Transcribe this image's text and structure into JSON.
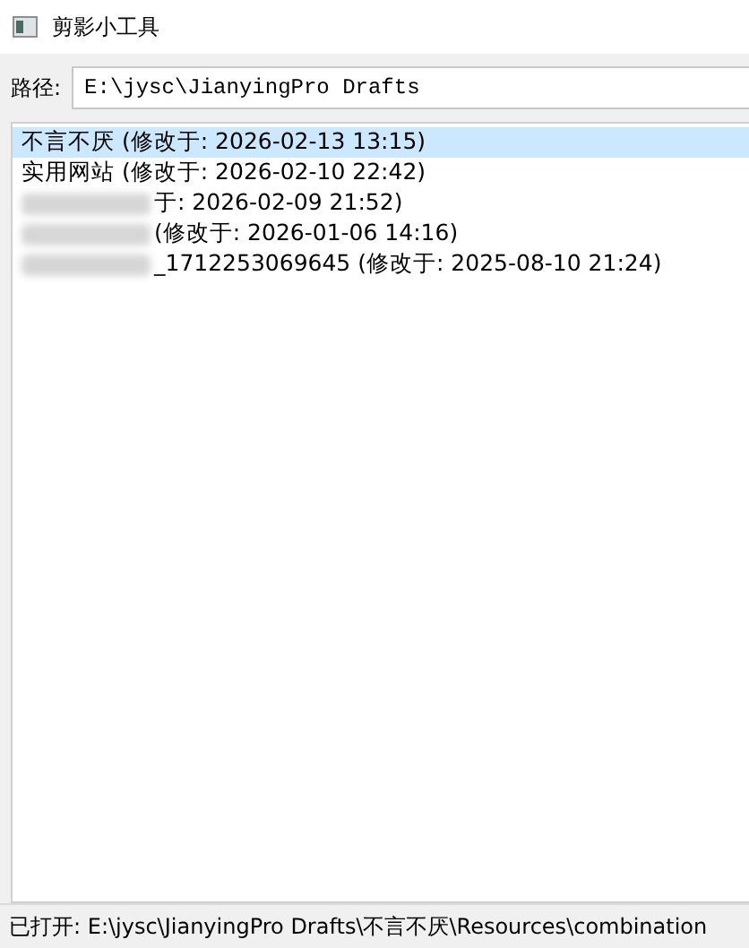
{
  "window": {
    "title": "剪影小工具"
  },
  "path": {
    "label": "路径:",
    "value": "E:\\jysc\\JianyingPro Drafts"
  },
  "drafts": [
    {
      "text": "不言不厌 (修改于: 2026-02-13 13:15)",
      "redacted": false,
      "selected": true
    },
    {
      "text": "实用网站 (修改于: 2026-02-10 22:42)",
      "redacted": false,
      "selected": false
    },
    {
      "text": "于: 2026-02-09 21:52)",
      "redacted": true,
      "selected": false
    },
    {
      "text": "(修改于: 2026-01-06 14:16)",
      "redacted": true,
      "selected": false
    },
    {
      "text": "_1712253069645 (修改于: 2025-08-10 21:24)",
      "redacted": true,
      "selected": false
    }
  ],
  "status_bar": "已打开: E:\\jysc\\JianyingPro Drafts\\不言不厌\\Resources\\combination"
}
